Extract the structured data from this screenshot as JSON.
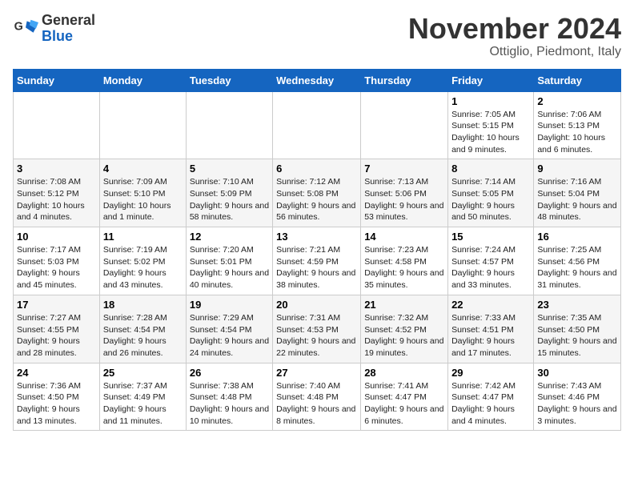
{
  "header": {
    "logo_line1": "General",
    "logo_line2": "Blue",
    "month_title": "November 2024",
    "location": "Ottiglio, Piedmont, Italy"
  },
  "days_of_week": [
    "Sunday",
    "Monday",
    "Tuesday",
    "Wednesday",
    "Thursday",
    "Friday",
    "Saturday"
  ],
  "weeks": [
    [
      {
        "day": "",
        "info": ""
      },
      {
        "day": "",
        "info": ""
      },
      {
        "day": "",
        "info": ""
      },
      {
        "day": "",
        "info": ""
      },
      {
        "day": "",
        "info": ""
      },
      {
        "day": "1",
        "info": "Sunrise: 7:05 AM\nSunset: 5:15 PM\nDaylight: 10 hours and 9 minutes."
      },
      {
        "day": "2",
        "info": "Sunrise: 7:06 AM\nSunset: 5:13 PM\nDaylight: 10 hours and 6 minutes."
      }
    ],
    [
      {
        "day": "3",
        "info": "Sunrise: 7:08 AM\nSunset: 5:12 PM\nDaylight: 10 hours and 4 minutes."
      },
      {
        "day": "4",
        "info": "Sunrise: 7:09 AM\nSunset: 5:10 PM\nDaylight: 10 hours and 1 minute."
      },
      {
        "day": "5",
        "info": "Sunrise: 7:10 AM\nSunset: 5:09 PM\nDaylight: 9 hours and 58 minutes."
      },
      {
        "day": "6",
        "info": "Sunrise: 7:12 AM\nSunset: 5:08 PM\nDaylight: 9 hours and 56 minutes."
      },
      {
        "day": "7",
        "info": "Sunrise: 7:13 AM\nSunset: 5:06 PM\nDaylight: 9 hours and 53 minutes."
      },
      {
        "day": "8",
        "info": "Sunrise: 7:14 AM\nSunset: 5:05 PM\nDaylight: 9 hours and 50 minutes."
      },
      {
        "day": "9",
        "info": "Sunrise: 7:16 AM\nSunset: 5:04 PM\nDaylight: 9 hours and 48 minutes."
      }
    ],
    [
      {
        "day": "10",
        "info": "Sunrise: 7:17 AM\nSunset: 5:03 PM\nDaylight: 9 hours and 45 minutes."
      },
      {
        "day": "11",
        "info": "Sunrise: 7:19 AM\nSunset: 5:02 PM\nDaylight: 9 hours and 43 minutes."
      },
      {
        "day": "12",
        "info": "Sunrise: 7:20 AM\nSunset: 5:01 PM\nDaylight: 9 hours and 40 minutes."
      },
      {
        "day": "13",
        "info": "Sunrise: 7:21 AM\nSunset: 4:59 PM\nDaylight: 9 hours and 38 minutes."
      },
      {
        "day": "14",
        "info": "Sunrise: 7:23 AM\nSunset: 4:58 PM\nDaylight: 9 hours and 35 minutes."
      },
      {
        "day": "15",
        "info": "Sunrise: 7:24 AM\nSunset: 4:57 PM\nDaylight: 9 hours and 33 minutes."
      },
      {
        "day": "16",
        "info": "Sunrise: 7:25 AM\nSunset: 4:56 PM\nDaylight: 9 hours and 31 minutes."
      }
    ],
    [
      {
        "day": "17",
        "info": "Sunrise: 7:27 AM\nSunset: 4:55 PM\nDaylight: 9 hours and 28 minutes."
      },
      {
        "day": "18",
        "info": "Sunrise: 7:28 AM\nSunset: 4:54 PM\nDaylight: 9 hours and 26 minutes."
      },
      {
        "day": "19",
        "info": "Sunrise: 7:29 AM\nSunset: 4:54 PM\nDaylight: 9 hours and 24 minutes."
      },
      {
        "day": "20",
        "info": "Sunrise: 7:31 AM\nSunset: 4:53 PM\nDaylight: 9 hours and 22 minutes."
      },
      {
        "day": "21",
        "info": "Sunrise: 7:32 AM\nSunset: 4:52 PM\nDaylight: 9 hours and 19 minutes."
      },
      {
        "day": "22",
        "info": "Sunrise: 7:33 AM\nSunset: 4:51 PM\nDaylight: 9 hours and 17 minutes."
      },
      {
        "day": "23",
        "info": "Sunrise: 7:35 AM\nSunset: 4:50 PM\nDaylight: 9 hours and 15 minutes."
      }
    ],
    [
      {
        "day": "24",
        "info": "Sunrise: 7:36 AM\nSunset: 4:50 PM\nDaylight: 9 hours and 13 minutes."
      },
      {
        "day": "25",
        "info": "Sunrise: 7:37 AM\nSunset: 4:49 PM\nDaylight: 9 hours and 11 minutes."
      },
      {
        "day": "26",
        "info": "Sunrise: 7:38 AM\nSunset: 4:48 PM\nDaylight: 9 hours and 10 minutes."
      },
      {
        "day": "27",
        "info": "Sunrise: 7:40 AM\nSunset: 4:48 PM\nDaylight: 9 hours and 8 minutes."
      },
      {
        "day": "28",
        "info": "Sunrise: 7:41 AM\nSunset: 4:47 PM\nDaylight: 9 hours and 6 minutes."
      },
      {
        "day": "29",
        "info": "Sunrise: 7:42 AM\nSunset: 4:47 PM\nDaylight: 9 hours and 4 minutes."
      },
      {
        "day": "30",
        "info": "Sunrise: 7:43 AM\nSunset: 4:46 PM\nDaylight: 9 hours and 3 minutes."
      }
    ]
  ]
}
